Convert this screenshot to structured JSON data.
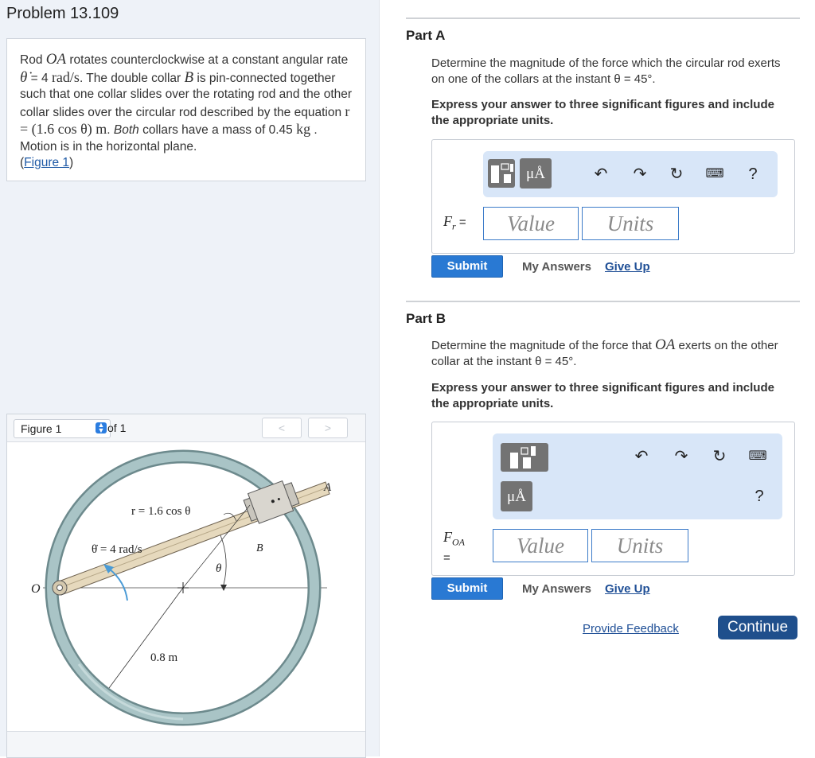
{
  "problem": {
    "title": "Problem 13.109",
    "text_parts": {
      "p1": "Rod ",
      "oa": "OA",
      "p2": " rotates counterclockwise at a constant angular rate ",
      "thetadot": "θ̇",
      "p3": " = 4 ",
      "unit1": "rad/s",
      "p4": ". The double collar ",
      "b": "B",
      "p5": " is pin-connected together such that one collar slides over the rotating rod and the other collar slides over the circular rod described by the equation ",
      "eq": "r = (1.6 cos θ) m",
      "p6": ". ",
      "both": "Both",
      "p7": " collars have a mass of 0.45 ",
      "kg": "kg",
      "p8": " . Motion is in the horizontal plane.",
      "fig_link": "Figure 1",
      "paren_open": "(",
      "paren_close": ")"
    }
  },
  "figure": {
    "select_label": "Figure 1",
    "of_label": "of 1",
    "prev": "<",
    "next": ">",
    "labels": {
      "A": "A",
      "O": "O",
      "B": "B",
      "r_eq": "r = 1.6 cos θ",
      "thetadot": "θ̇ = 4 rad/s",
      "theta": "θ",
      "radius": "0.8 m"
    }
  },
  "partA": {
    "title": "Part A",
    "question": "Determine the magnitude of the force which the circular rod exerts on one of the collars at the instant θ = 45°.",
    "instruction": "Express your answer to three significant figures and include the appropriate units.",
    "label": "F",
    "label_sub": "r",
    "label_eq": "=",
    "value_placeholder": "Value",
    "units_placeholder": "Units",
    "mu_label": "μÅ",
    "help": "?",
    "submit": "Submit",
    "my_answers": "My Answers",
    "give_up": "Give Up"
  },
  "partB": {
    "title": "Part B",
    "question_pre": "Determine the magnitude of the force that ",
    "question_oa": "OA",
    "question_post": " exerts on the other collar at the instant θ = 45°.",
    "instruction": "Express your answer to three significant figures and include the appropriate units.",
    "label": "F",
    "label_sub": "OA",
    "label_eq": "=",
    "value_placeholder": "Value",
    "units_placeholder": "Units",
    "mu_label": "μÅ",
    "help": "?",
    "submit": "Submit",
    "my_answers": "My Answers",
    "give_up": "Give Up"
  },
  "footer": {
    "feedback": "Provide Feedback",
    "continue": "Continue"
  }
}
